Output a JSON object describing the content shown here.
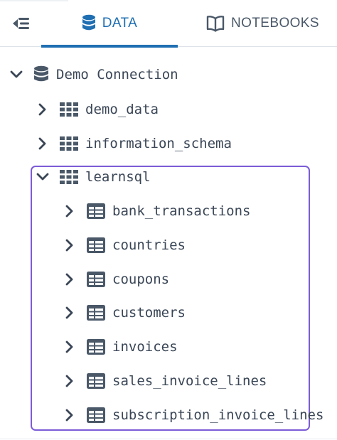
{
  "header": {
    "tabs": [
      {
        "label": "DATA",
        "active": true
      },
      {
        "label": "NOTEBOOKS",
        "active": false
      }
    ]
  },
  "tree": {
    "connection": {
      "label": "Demo Connection",
      "expanded": true
    },
    "schemas": [
      {
        "label": "demo_data",
        "expanded": false
      },
      {
        "label": "information_schema",
        "expanded": false
      },
      {
        "label": "learnsql",
        "expanded": true
      }
    ],
    "tables": [
      {
        "label": "bank_transactions"
      },
      {
        "label": "countries"
      },
      {
        "label": "coupons"
      },
      {
        "label": "customers"
      },
      {
        "label": "invoices"
      },
      {
        "label": "sales_invoice_lines"
      },
      {
        "label": "subscription_invoice_lines"
      }
    ]
  },
  "colors": {
    "accent": "#1f6fb2",
    "highlight": "#7c5cd6",
    "icon": "#4a5868"
  }
}
